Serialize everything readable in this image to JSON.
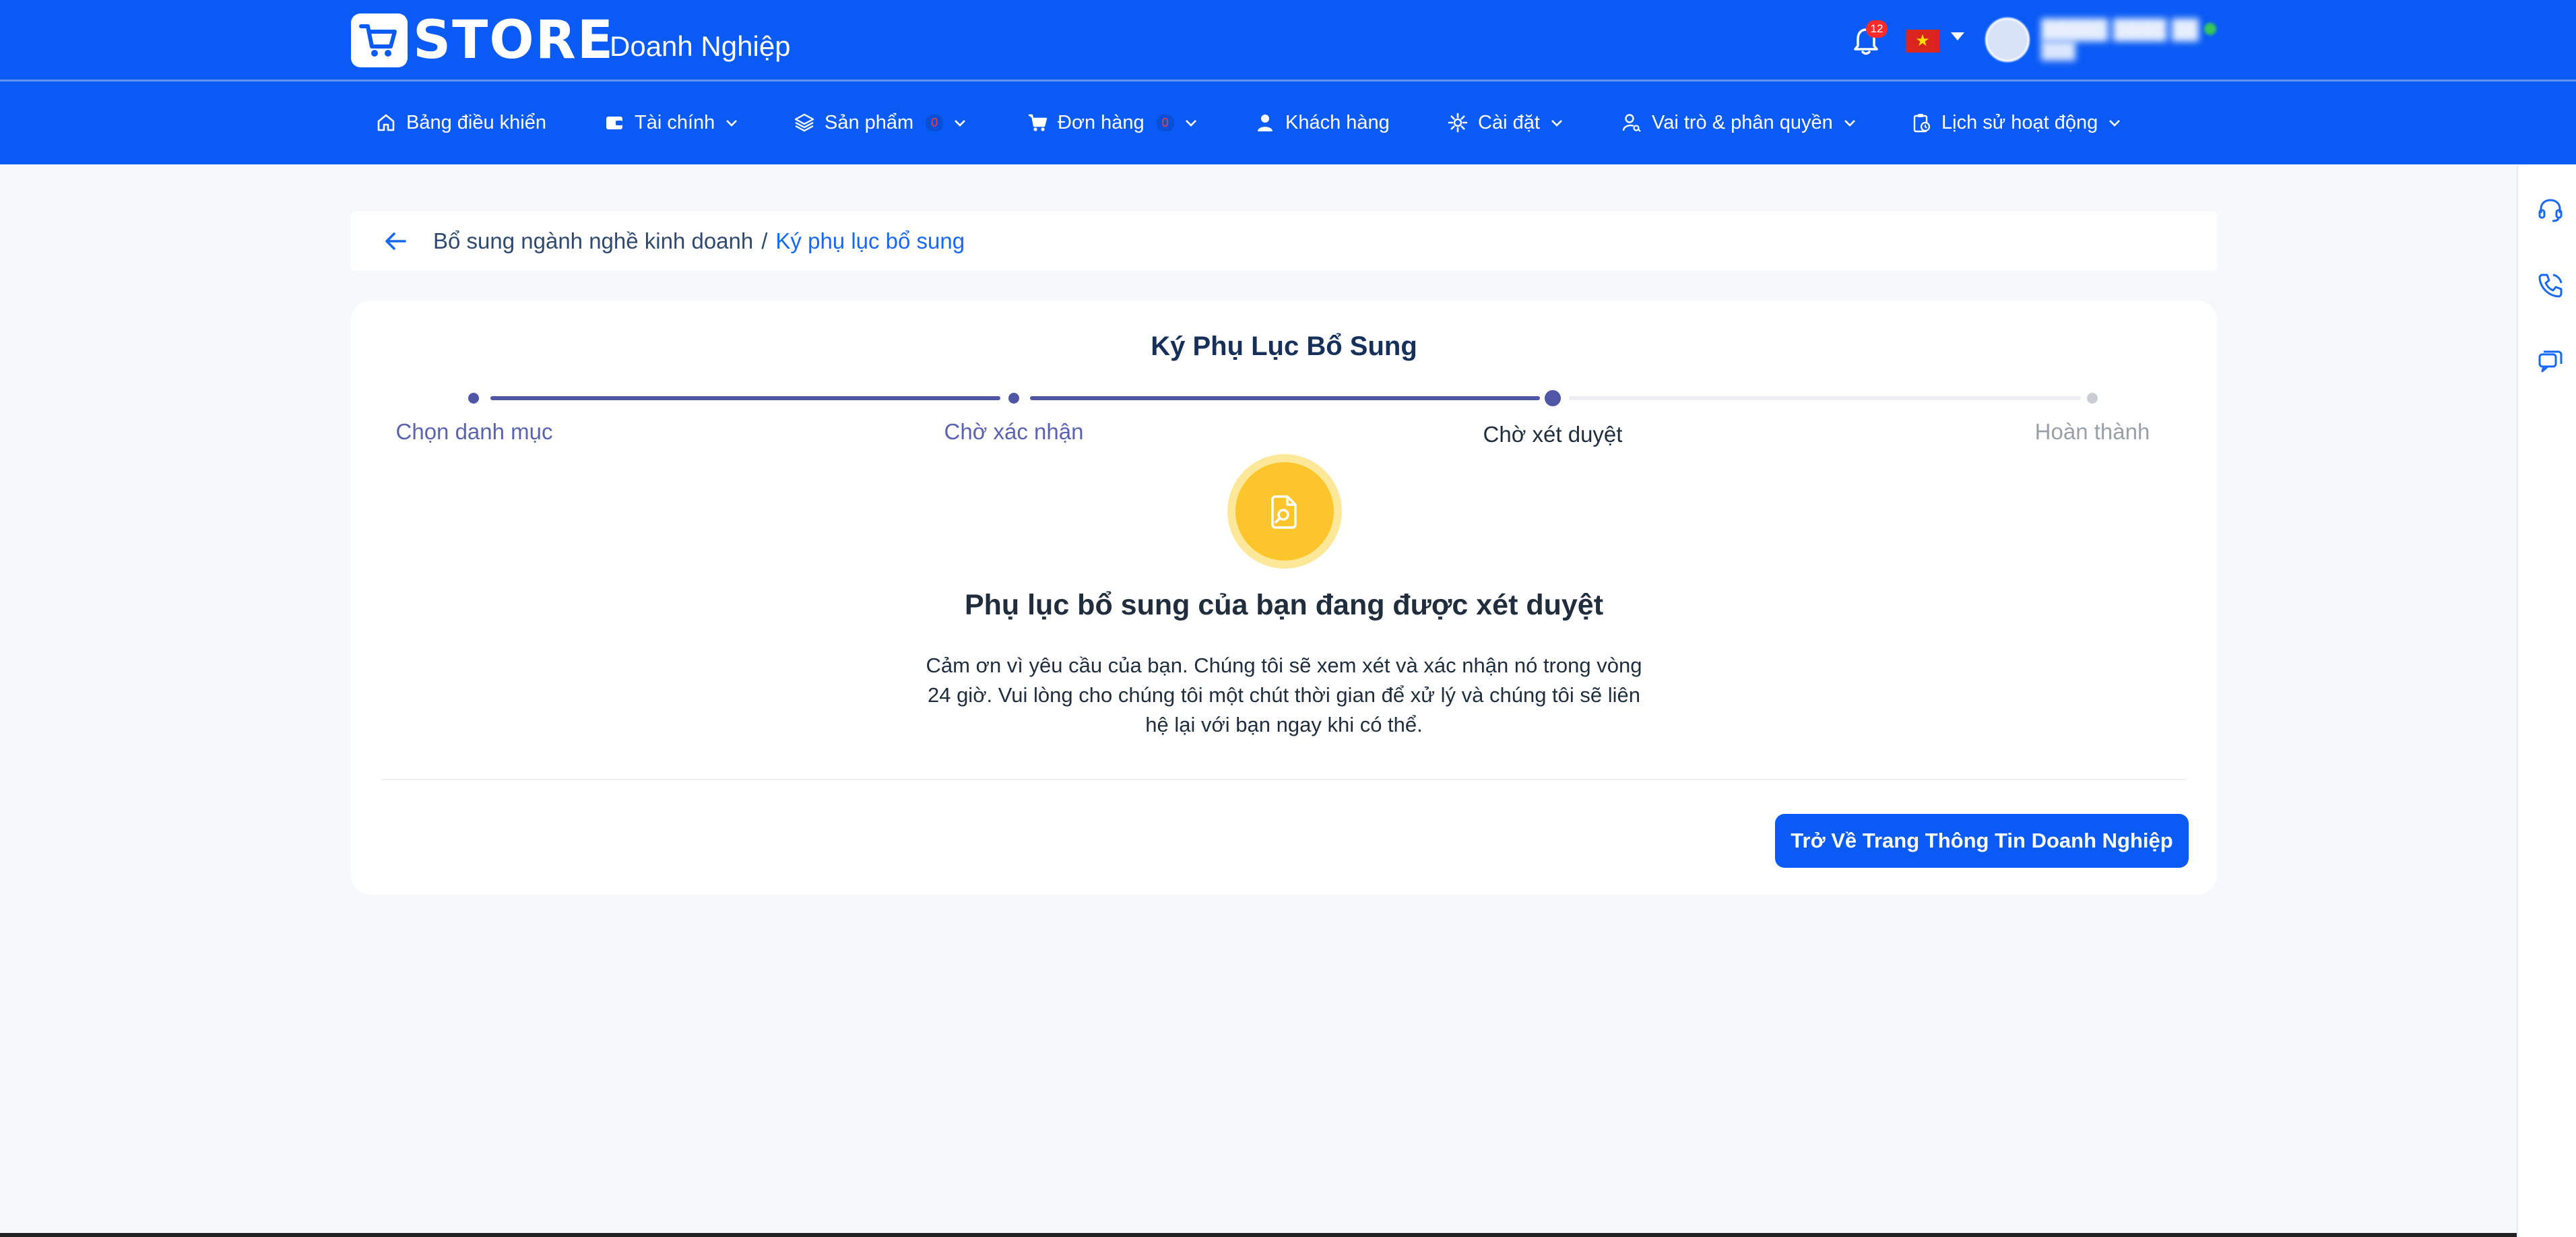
{
  "header": {
    "brand_logo_text": "STORE",
    "brand_subtitle": "Doanh Nghiệp",
    "notification_count": "12",
    "language_flag": "vn-flag",
    "brand_color": "#0a5bf5"
  },
  "nav": {
    "items": [
      {
        "label": "Bảng điều khiển",
        "icon": "home-icon"
      },
      {
        "label": "Tài chính",
        "icon": "wallet-icon"
      },
      {
        "label": "Sản phẩm",
        "icon": "layers-icon",
        "count": "0"
      },
      {
        "label": "Đơn hàng",
        "icon": "cart-icon",
        "count": "0"
      },
      {
        "label": "Khách hàng",
        "icon": "user-icon"
      },
      {
        "label": "Cài đặt",
        "icon": "gear-icon"
      },
      {
        "label": "Vai trò & phân quyền",
        "icon": "user-key-icon"
      },
      {
        "label": "Lịch sử hoạt động",
        "icon": "clipboard-clock-icon"
      }
    ]
  },
  "breadcrumb": {
    "parent": "Bổ sung ngành nghề kinh doanh",
    "separator": "/",
    "current": "Ký phụ lục bổ sung"
  },
  "page": {
    "title": "Ký Phụ Lục Bổ Sung",
    "steps": [
      {
        "label": "Chọn danh mục",
        "state": "done"
      },
      {
        "label": "Chờ xác nhận",
        "state": "done"
      },
      {
        "label": "Chờ xét duyệt",
        "state": "current"
      },
      {
        "label": "Hoàn thành",
        "state": "pending"
      }
    ],
    "status_icon": "document-search-icon",
    "headline": "Phụ lục bổ sung của bạn đang được xét duyệt",
    "description": "Cảm ơn vì yêu cầu của bạn. Chúng tôi sẽ xem xét và xác nhận nó trong vòng 24 giờ. Vui lòng cho chúng tôi một chút thời gian để xử lý và chúng tôi sẽ liên hệ lại với bạn ngay khi có thể.",
    "back_button_label": "Trở Về Trang Thông Tin Doanh Nghiệp"
  },
  "colors": {
    "step_done": "#4f56a6",
    "step_pending": "#c9ccd2",
    "status_yellow": "#fcc52b",
    "link_blue": "#1668f5"
  }
}
